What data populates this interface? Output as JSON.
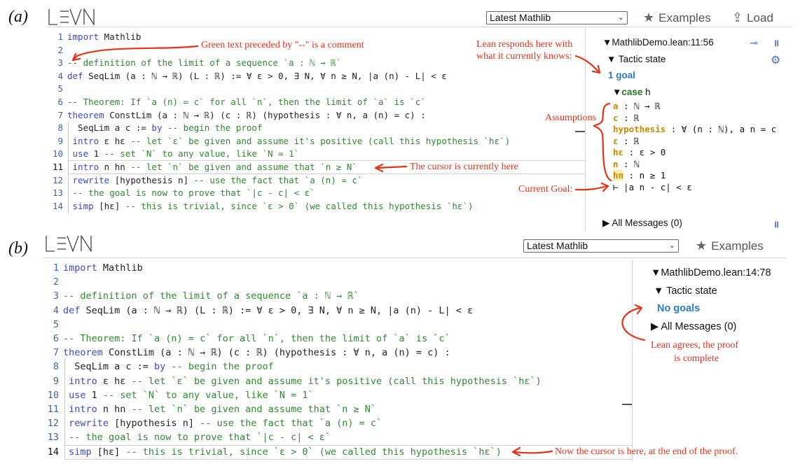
{
  "panels": {
    "a": {
      "label": "(a)",
      "select_value": "Latest Mathlib",
      "examples_label": "Examples",
      "load_label": "Load",
      "code_lines": [
        {
          "n": "1",
          "segs": [
            [
              "kw",
              "import"
            ],
            [
              "nm",
              " Mathlib"
            ]
          ]
        },
        {
          "n": "2",
          "segs": []
        },
        {
          "n": "3",
          "segs": [
            [
              "cm",
              "-- definition of the limit of a sequence `a : ℕ → ℝ`"
            ]
          ]
        },
        {
          "n": "4",
          "segs": [
            [
              "kw",
              "def"
            ],
            [
              "nm",
              " SeqLim (a : ℕ → ℝ) (L : ℝ) := ∀ ε > 0, ∃ N, ∀ n ≥ N, |a (n) - L| < ε"
            ]
          ]
        },
        {
          "n": "5",
          "segs": []
        },
        {
          "n": "6",
          "segs": [
            [
              "cm",
              "-- Theorem: If `a (n) = c` for all `n`, then the limit of `a` is `c`"
            ]
          ]
        },
        {
          "n": "7",
          "segs": [
            [
              "kw",
              "theorem"
            ],
            [
              "nm",
              " ConstLim (a : ℕ → ℝ) (c : ℝ) (hypothesis : ∀ n, a (n) = c) :"
            ]
          ]
        },
        {
          "n": "8",
          "segs": [
            [
              "nm",
              "  SeqLim a c := "
            ],
            [
              "kw",
              "by"
            ],
            [
              "cm",
              " -- begin the proof"
            ]
          ]
        },
        {
          "n": "9",
          "segs": [
            [
              "kw",
              " intro"
            ],
            [
              "nm",
              " ε hε "
            ],
            [
              "cm",
              "-- let `ε` be given and assume it's positive (call this hypothesis `hε`)"
            ]
          ]
        },
        {
          "n": "10",
          "segs": [
            [
              "kw",
              " use"
            ],
            [
              "nm",
              " 1 "
            ],
            [
              "cm",
              "-- set `N` to any value, like `N = 1`"
            ]
          ]
        },
        {
          "n": "11",
          "segs": [
            [
              "kw",
              " intro"
            ],
            [
              "nm",
              " n hn "
            ],
            [
              "cm",
              "-- let `n` be given and assume that `n ≥ N`"
            ]
          ]
        },
        {
          "n": "12",
          "segs": [
            [
              "kw",
              " rewrite"
            ],
            [
              "nm",
              " [hypothesis n] "
            ],
            [
              "cm",
              "-- use the fact that `a (n) = c`"
            ]
          ]
        },
        {
          "n": "13",
          "segs": [
            [
              "cm",
              " -- the goal is now to prove that `|c - c| < ε`"
            ]
          ]
        },
        {
          "n": "14",
          "segs": [
            [
              "kw",
              " simp"
            ],
            [
              "nm",
              " [hε] "
            ],
            [
              "cm",
              "-- this is trivial, since `ε > 0` (we called this hypothesis `hε`)"
            ]
          ]
        }
      ],
      "infoview": {
        "file_pos": "▼MathlibDemo.lean:11:56",
        "tactic_state": "▼ Tactic state",
        "goals": "1 goal",
        "case_arrow": "▼",
        "case_kw": "case",
        "case_name": " h",
        "hyps": [
          {
            "name": "a",
            "rest": " : ℕ → ℝ"
          },
          {
            "name": "c",
            "rest": " : ℝ"
          },
          {
            "name": "hypothesis",
            "rest": " : ∀ (n : ℕ), a n = c"
          },
          {
            "name": "ε",
            "rest": " : ℝ"
          },
          {
            "name": "hε",
            "rest": " : ε > 0"
          },
          {
            "name": "n",
            "rest": " : ℕ"
          },
          {
            "name": "hn",
            "rest": " : n ≥ 1"
          }
        ],
        "goal_line": "⊢ |a n - c| < ε",
        "all_messages": "▶ All Messages (0)"
      },
      "annotations": {
        "comment": "Green text preceded by \"--\" is a comment",
        "lean_responds_1": "Lean responds here with",
        "lean_responds_2": "what it currently knows:",
        "assumptions": "Assumptions",
        "cursor": "The cursor is currently here",
        "current_goal": "Current Goal:"
      }
    },
    "b": {
      "label": "(b)",
      "select_value": "Latest Mathlib",
      "examples_label": "Examples",
      "infoview": {
        "file_pos": "▼MathlibDemo.lean:14:78",
        "tactic_state": "▼ Tactic state",
        "goals": "No goals",
        "all_messages": "▶ All Messages (0)"
      },
      "annotations": {
        "lean_agrees_1": "Lean agrees, the proof",
        "lean_agrees_2": "is complete",
        "cursor_end": "Now the cursor is here, at the end of the proof."
      }
    }
  },
  "icons": [
    "star-icon",
    "upload-icon",
    "pin-icon",
    "pause-icon",
    "gear-icon",
    "chevron-down-icon"
  ],
  "colors": {
    "keyword": "#3a4bc0",
    "comment": "#2f8a2f",
    "annotation": "#e53318",
    "goal": "#2e7bbd",
    "hypothesis_name": "#c98a00"
  }
}
